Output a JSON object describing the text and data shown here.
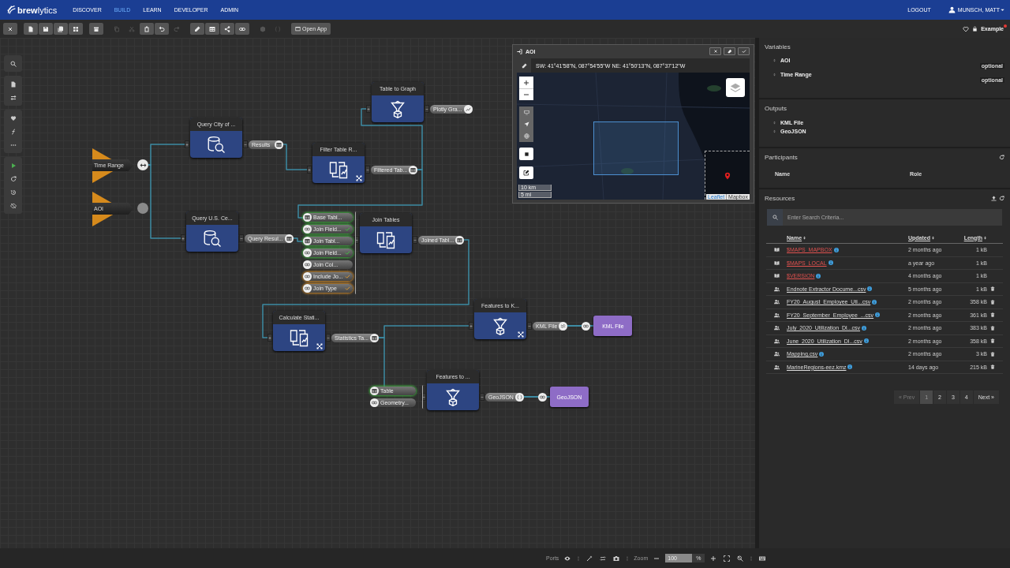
{
  "nav": {
    "logo": "**brew**lytics",
    "items": [
      {
        "label": "DISCOVER",
        "selected": false
      },
      {
        "label": "BUILD",
        "selected": true
      },
      {
        "label": "LEARN",
        "selected": false
      },
      {
        "label": "DEVELOPER",
        "selected": false
      },
      {
        "label": "ADMIN",
        "selected": false
      }
    ],
    "logout": "LOGOUT",
    "user": "MUNSCH, MATT"
  },
  "toolbar": {
    "groups": [
      {
        "tools": [
          {
            "kind": "close",
            "disabled": false
          }
        ]
      },
      {
        "tools": [
          {
            "kind": "file",
            "disabled": false
          },
          {
            "kind": "save",
            "disabled": false
          },
          {
            "kind": "save-all",
            "disabled": false
          },
          {
            "kind": "grid",
            "disabled": false
          }
        ]
      },
      {
        "tools": [
          {
            "kind": "archive",
            "disabled": false
          }
        ]
      },
      {
        "tools": [
          {
            "kind": "copy",
            "disabled": true
          },
          {
            "kind": "cut",
            "disabled": true
          },
          {
            "kind": "paste",
            "disabled": false
          },
          {
            "kind": "undo",
            "disabled": false
          },
          {
            "kind": "redo",
            "disabled": true
          }
        ]
      },
      {
        "tools": [
          {
            "kind": "pencil",
            "disabled": false
          },
          {
            "kind": "table",
            "disabled": false
          },
          {
            "kind": "share",
            "disabled": false
          },
          {
            "kind": "link",
            "disabled": false
          }
        ]
      },
      {
        "tools": [
          {
            "kind": "cube",
            "disabled": true
          },
          {
            "kind": "braces",
            "disabled": true
          }
        ]
      }
    ],
    "open_app": "Open App",
    "favorite": false,
    "locked": true,
    "workspace": "Example",
    "modified": true
  },
  "side_tools": [
    {
      "tools": [
        {
          "kind": "search"
        }
      ]
    },
    {
      "tools": [
        {
          "kind": "file"
        },
        {
          "kind": "swap"
        }
      ]
    },
    {
      "tools": [
        {
          "kind": "heart-fill"
        },
        {
          "kind": "function"
        },
        {
          "kind": "dots"
        }
      ]
    },
    {
      "tools": [
        {
          "kind": "play"
        },
        {
          "kind": "refresh"
        },
        {
          "kind": "history"
        },
        {
          "kind": "eye-off"
        }
      ]
    }
  ],
  "canvas": {
    "variables": [
      {
        "label": "Time Range",
        "set": true
      },
      {
        "label": "AOI",
        "set": false
      }
    ],
    "nodes": [
      {
        "title": "Table to Graph",
        "tools": false,
        "output": {
          "label": "Plotly Gra..."
        }
      },
      {
        "title": "Query City of ...",
        "tools": false,
        "output": {
          "label": "Results"
        }
      },
      {
        "title": "Filter Table R...",
        "tools": true,
        "output": {
          "label": "Filtered Tab..."
        }
      },
      {
        "title": "Query U.S. Ce...",
        "tools": false,
        "output": {
          "label": "Query Resul..."
        }
      },
      {
        "title": "Join Tables",
        "tools": false,
        "inputs": [
          {
            "label": "Base Tabl...",
            "connected": true,
            "defaulted": false,
            "checked": false
          },
          {
            "label": "Join Field...",
            "connected": true,
            "defaulted": false,
            "checked": true
          },
          {
            "label": "Join Tabl...",
            "connected": true,
            "defaulted": false,
            "checked": false
          },
          {
            "label": "Join Field...",
            "connected": true,
            "defaulted": false,
            "checked": true
          },
          {
            "label": "Join Col...",
            "connected": false,
            "defaulted": false,
            "checked": false
          },
          {
            "label": "Include Jo...",
            "connected": false,
            "defaulted": true,
            "checked": true
          },
          {
            "label": "Join Type",
            "connected": false,
            "defaulted": true,
            "checked": true
          }
        ],
        "output": {
          "label": "Joined Tabl..."
        }
      },
      {
        "title": "Calculate Stati...",
        "tools": true,
        "output": {
          "label": "Statistics Ta..."
        }
      },
      {
        "title": "Features to K...",
        "tools": true,
        "output": {
          "label": "KML File"
        },
        "target": "KML File"
      },
      {
        "title": "Features to ...",
        "tools": false,
        "inputs": [
          {
            "label": "Table",
            "connected": true,
            "defaulted": false,
            "checked": false
          },
          {
            "label": "Geometry...",
            "connected": false,
            "defaulted": false,
            "checked": false
          }
        ],
        "output": {
          "label": "GeoJSON"
        },
        "target": "GeoJSON"
      }
    ]
  },
  "map": {
    "title": "AOI",
    "bounds": "SW: 41°41'58\"N, 087°54'55\"W NE: 41°50'13\"N, 087°37'12\"W",
    "scale": [
      "10 km",
      "5 mi"
    ],
    "attribution": {
      "link": "Leaflet",
      "source": "Mapbox"
    }
  },
  "panel": {
    "variables": {
      "title": "Variables",
      "items": [
        {
          "label": "AOI",
          "tag": "optional"
        },
        {
          "label": "Time Range",
          "tag": "optional"
        }
      ]
    },
    "outputs": {
      "title": "Outputs",
      "items": [
        {
          "label": "KML File"
        },
        {
          "label": "GeoJSON"
        }
      ]
    },
    "participants": {
      "title": "Participants",
      "columns": [
        "Name",
        "Role"
      ]
    },
    "resources": {
      "title": "Resources",
      "search": {
        "placeholder": "Enter Search Criteria..."
      },
      "columns": [
        "Name",
        "Updated",
        "Length"
      ],
      "rows": [
        {
          "kind": "system",
          "name": "$MAPS_MAPBOX",
          "updated": "2 months ago",
          "length": "1 kB"
        },
        {
          "kind": "system",
          "name": "$MAPS_LOCAL",
          "updated": "a year ago",
          "length": "1 kB"
        },
        {
          "kind": "system",
          "name": "$VERSION",
          "updated": "4 months ago",
          "length": "1 kB"
        },
        {
          "kind": "file",
          "name": "Endnote Extractor Docume...csv",
          "updated": "5 months ago",
          "length": "1 kB"
        },
        {
          "kind": "file",
          "name": "FY20_August_Employee_Uti...csv",
          "updated": "2 months ago",
          "length": "358 kB"
        },
        {
          "kind": "file",
          "name": "FY20_September_Employee_...csv",
          "updated": "2 months ago",
          "length": "361 kB"
        },
        {
          "kind": "file",
          "name": "July_2020_Utilization_Dl...csv",
          "updated": "2 months ago",
          "length": "383 kB"
        },
        {
          "kind": "file",
          "name": "June_2020_Utilization_Dl...csv",
          "updated": "2 months ago",
          "length": "358 kB"
        },
        {
          "kind": "file",
          "name": "Mapping.csv",
          "updated": "2 months ago",
          "length": "3 kB"
        },
        {
          "kind": "file",
          "name": "MarineRegions-eez.kmz",
          "updated": "14 days ago",
          "length": "215 kB"
        }
      ],
      "pagination": [
        {
          "label": "« Prev",
          "selected": false,
          "disabled": true
        },
        {
          "label": "1",
          "selected": true,
          "disabled": false
        },
        {
          "label": "2",
          "selected": false,
          "disabled": false
        },
        {
          "label": "3",
          "selected": false,
          "disabled": false
        },
        {
          "label": "4",
          "selected": false,
          "disabled": false
        },
        {
          "label": "Next »",
          "selected": false,
          "disabled": false
        }
      ]
    }
  },
  "status_bar": {
    "items": [
      {
        "kind": "label",
        "text": "Ports"
      },
      {
        "kind": "eye"
      },
      {
        "kind": "separator"
      },
      {
        "kind": "wand"
      },
      {
        "kind": "shuffle"
      },
      {
        "kind": "camera"
      },
      {
        "kind": "separator"
      },
      {
        "kind": "label",
        "text": "Zoom"
      },
      {
        "kind": "minus"
      },
      {
        "kind": "field",
        "value": "100"
      },
      {
        "kind": "unit",
        "text": "%"
      },
      {
        "kind": "plus"
      },
      {
        "kind": "expand"
      },
      {
        "kind": "search-off"
      },
      {
        "kind": "separator"
      },
      {
        "kind": "keyboard"
      }
    ]
  }
}
